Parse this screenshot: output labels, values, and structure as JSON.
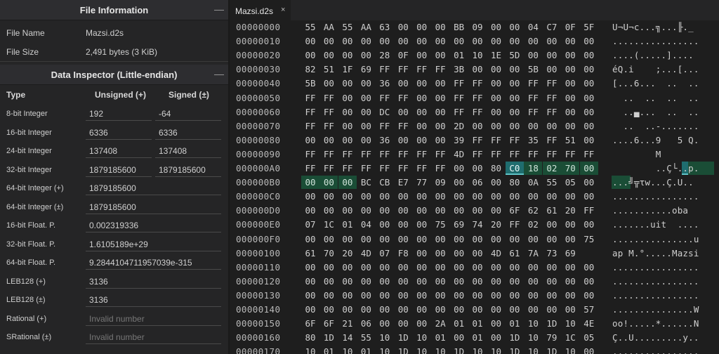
{
  "file_info": {
    "title": "File Information",
    "collapse_glyph": "—",
    "rows": [
      {
        "label": "File Name",
        "value": "Mazsi.d2s"
      },
      {
        "label": "File Size",
        "value": "2,491 bytes (3 KiB)"
      }
    ]
  },
  "data_inspector": {
    "title": "Data Inspector (Little-endian)",
    "collapse_glyph": "—",
    "headers": {
      "type": "Type",
      "unsigned": "Unsigned (+)",
      "signed": "Signed (±)"
    },
    "rows": [
      {
        "type": "8-bit Integer",
        "unsigned": "192",
        "signed": "-64"
      },
      {
        "type": "16-bit Integer",
        "unsigned": "6336",
        "signed": "6336"
      },
      {
        "type": "24-bit Integer",
        "unsigned": "137408",
        "signed": "137408"
      },
      {
        "type": "32-bit Integer",
        "unsigned": "1879185600",
        "signed": "1879185600"
      },
      {
        "type": "64-bit Integer (+)",
        "unsigned": "1879185600"
      },
      {
        "type": "64-bit Integer (±)",
        "unsigned": "1879185600"
      },
      {
        "type": "16-bit Float. P.",
        "unsigned": "0.002319336"
      },
      {
        "type": "32-bit Float. P.",
        "unsigned": "1.6105189e+29"
      },
      {
        "type": "64-bit Float. P.",
        "unsigned": "9.2844104711957039e-315"
      },
      {
        "type": "LEB128 (+)",
        "unsigned": "3136"
      },
      {
        "type": "LEB128 (±)",
        "unsigned": "3136"
      },
      {
        "type": "Rational (+)",
        "placeholder": "Invalid number"
      },
      {
        "type": "SRational (±)",
        "placeholder": "Invalid number"
      }
    ]
  },
  "tab": {
    "label": "Mazsi.d2s",
    "close_glyph": "×"
  },
  "hex": {
    "rows": [
      {
        "addr": "00000000",
        "bytes": [
          "55",
          "AA",
          "55",
          "AA",
          "63",
          "00",
          "00",
          "00",
          "BB",
          "09",
          "00",
          "00",
          "04",
          "C7",
          "0F",
          "5F"
        ],
        "ascii": "U¬U¬c...╗...╟._"
      },
      {
        "addr": "00000010",
        "bytes": [
          "00",
          "00",
          "00",
          "00",
          "00",
          "00",
          "00",
          "00",
          "00",
          "00",
          "00",
          "00",
          "00",
          "00",
          "00",
          "00"
        ],
        "ascii": "................"
      },
      {
        "addr": "00000020",
        "bytes": [
          "00",
          "00",
          "00",
          "00",
          "28",
          "0F",
          "00",
          "00",
          "01",
          "10",
          "1E",
          "5D",
          "00",
          "00",
          "00",
          "00"
        ],
        "ascii": "....(.....].... "
      },
      {
        "addr": "00000030",
        "bytes": [
          "82",
          "51",
          "1F",
          "69",
          "FF",
          "FF",
          "FF",
          "FF",
          "3B",
          "00",
          "00",
          "00",
          "5B",
          "00",
          "00",
          "00"
        ],
        "ascii": "éQ.i    ;...[..."
      },
      {
        "addr": "00000040",
        "bytes": [
          "5B",
          "00",
          "00",
          "00",
          "36",
          "00",
          "00",
          "00",
          "FF",
          "FF",
          "00",
          "00",
          "FF",
          "FF",
          "00",
          "00"
        ],
        "ascii": "[...6...  ..  .."
      },
      {
        "addr": "00000050",
        "bytes": [
          "FF",
          "FF",
          "00",
          "00",
          "FF",
          "FF",
          "00",
          "00",
          "FF",
          "FF",
          "00",
          "00",
          "FF",
          "FF",
          "00",
          "00"
        ],
        "ascii": "  ..  ..  ..  .."
      },
      {
        "addr": "00000060",
        "bytes": [
          "FF",
          "FF",
          "00",
          "00",
          "DC",
          "00",
          "00",
          "00",
          "FF",
          "FF",
          "00",
          "00",
          "FF",
          "FF",
          "00",
          "00"
        ],
        "ascii": "  ..▄...  ..  .."
      },
      {
        "addr": "00000070",
        "bytes": [
          "FF",
          "FF",
          "00",
          "00",
          "FF",
          "FF",
          "00",
          "00",
          "2D",
          "00",
          "00",
          "00",
          "00",
          "00",
          "00",
          "00"
        ],
        "ascii": "  ..  ..-......."
      },
      {
        "addr": "00000080",
        "bytes": [
          "00",
          "00",
          "00",
          "00",
          "36",
          "00",
          "00",
          "00",
          "39",
          "FF",
          "FF",
          "FF",
          "35",
          "FF",
          "51",
          "00"
        ],
        "ascii": "....6...9   5 Q."
      },
      {
        "addr": "00000090",
        "bytes": [
          "FF",
          "FF",
          "FF",
          "FF",
          "FF",
          "FF",
          "FF",
          "FF",
          "4D",
          "FF",
          "FF",
          "FF",
          "FF",
          "FF",
          "FF",
          "FF"
        ],
        "ascii": "        M       "
      },
      {
        "addr": "000000A0",
        "bytes": [
          "FF",
          "FF",
          "FF",
          "FF",
          "FF",
          "FF",
          "FF",
          "FF",
          "00",
          "00",
          "80",
          "C0",
          "18",
          "02",
          "70",
          "00"
        ],
        "ascii": "        ..Ç└..p."
      },
      {
        "addr": "000000B0",
        "bytes": [
          "00",
          "00",
          "00",
          "BC",
          "CB",
          "E7",
          "77",
          "09",
          "00",
          "06",
          "00",
          "80",
          "0A",
          "55",
          "05",
          "00"
        ],
        "ascii": "...╝╦τw...Ç.U.."
      },
      {
        "addr": "000000C0",
        "bytes": [
          "00",
          "00",
          "00",
          "00",
          "00",
          "00",
          "00",
          "00",
          "00",
          "00",
          "00",
          "00",
          "00",
          "00",
          "00",
          "00"
        ],
        "ascii": "................"
      },
      {
        "addr": "000000D0",
        "bytes": [
          "00",
          "00",
          "00",
          "00",
          "00",
          "00",
          "00",
          "00",
          "00",
          "00",
          "00",
          "6F",
          "62",
          "61",
          "20",
          "FF"
        ],
        "ascii": "...........oba  "
      },
      {
        "addr": "000000E0",
        "bytes": [
          "07",
          "1C",
          "01",
          "04",
          "00",
          "00",
          "00",
          "75",
          "69",
          "74",
          "20",
          "FF",
          "02",
          "00",
          "00",
          "00"
        ],
        "ascii": ".......uit  ...."
      },
      {
        "addr": "000000F0",
        "bytes": [
          "00",
          "00",
          "00",
          "00",
          "00",
          "00",
          "00",
          "00",
          "00",
          "00",
          "00",
          "00",
          "00",
          "00",
          "00",
          "75"
        ],
        "ascii": "...............u"
      },
      {
        "addr": "00000100",
        "bytes": [
          "61",
          "70",
          "20",
          "4D",
          "07",
          "F8",
          "00",
          "00",
          "00",
          "00",
          "4D",
          "61",
          "7A",
          "73",
          "69"
        ],
        "ascii": "ap M.°.....Mazsi"
      },
      {
        "addr": "00000110",
        "bytes": [
          "00",
          "00",
          "00",
          "00",
          "00",
          "00",
          "00",
          "00",
          "00",
          "00",
          "00",
          "00",
          "00",
          "00",
          "00",
          "00"
        ],
        "ascii": "................"
      },
      {
        "addr": "00000120",
        "bytes": [
          "00",
          "00",
          "00",
          "00",
          "00",
          "00",
          "00",
          "00",
          "00",
          "00",
          "00",
          "00",
          "00",
          "00",
          "00",
          "00"
        ],
        "ascii": "................"
      },
      {
        "addr": "00000130",
        "bytes": [
          "00",
          "00",
          "00",
          "00",
          "00",
          "00",
          "00",
          "00",
          "00",
          "00",
          "00",
          "00",
          "00",
          "00",
          "00",
          "00"
        ],
        "ascii": "................"
      },
      {
        "addr": "00000140",
        "bytes": [
          "00",
          "00",
          "00",
          "00",
          "00",
          "00",
          "00",
          "00",
          "00",
          "00",
          "00",
          "00",
          "00",
          "00",
          "00",
          "57"
        ],
        "ascii": "...............W"
      },
      {
        "addr": "00000150",
        "bytes": [
          "6F",
          "6F",
          "21",
          "06",
          "00",
          "00",
          "00",
          "2A",
          "01",
          "01",
          "00",
          "01",
          "10",
          "1D",
          "10",
          "4E"
        ],
        "ascii": "oo!.....*......N"
      },
      {
        "addr": "00000160",
        "bytes": [
          "80",
          "1D",
          "14",
          "55",
          "10",
          "1D",
          "10",
          "01",
          "00",
          "01",
          "00",
          "1D",
          "10",
          "79",
          "1C",
          "05"
        ],
        "ascii": "Ç..U.........y.."
      },
      {
        "addr": "00000170",
        "bytes": [
          "10",
          "01",
          "10",
          "01",
          "10",
          "1D",
          "10",
          "10",
          "1D",
          "10",
          "10",
          "1D",
          "10",
          "1D",
          "10",
          "00"
        ],
        "ascii": "................"
      }
    ],
    "selected": {
      "row": 10,
      "col": 11
    },
    "highlight": [
      {
        "row": 10,
        "from": 12,
        "to": 15
      },
      {
        "row": 11,
        "from": 0,
        "to": 2
      }
    ]
  }
}
